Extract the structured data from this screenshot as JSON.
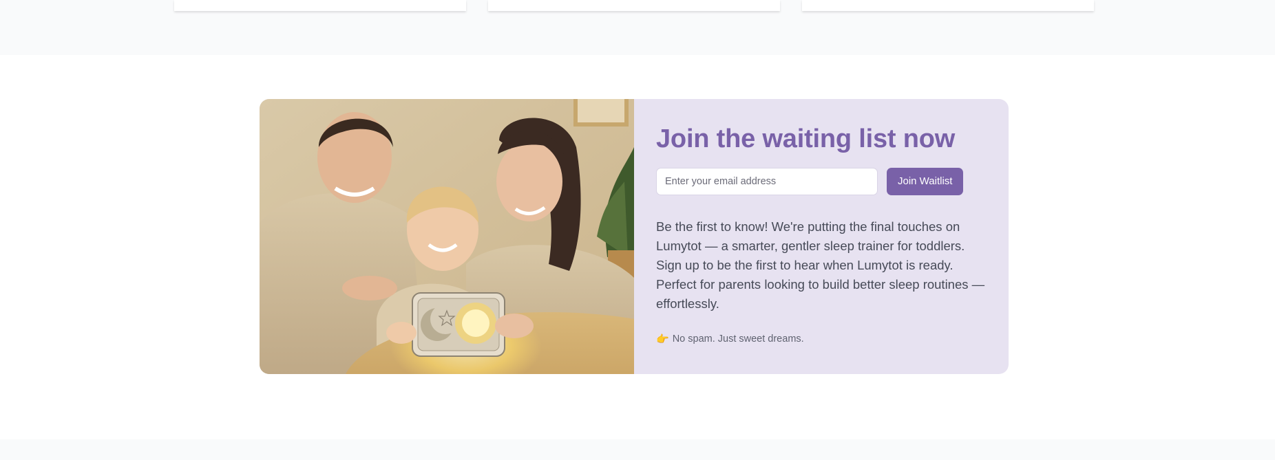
{
  "top_cards": [
    "card-1",
    "card-2",
    "card-3"
  ],
  "waitlist": {
    "headline": "Join the waiting list now",
    "email_placeholder": "Enter your email address",
    "email_value": "",
    "button_label": "Join Waitlist",
    "description": "Be the first to know! We're putting the final touches on Lumytot — a smarter, gentler sleep trainer for toddlers. Sign up to be the first to hear when Lumytot is ready. Perfect for parents looking to build better sleep routines — effortlessly.",
    "note_emoji": "👉",
    "note_text": "No spam. Just sweet dreams."
  },
  "colors": {
    "accent": "#7961a8",
    "panel_bg": "#e7e2f1",
    "band_bg": "#f9fafb",
    "text": "#464a57"
  },
  "photo": {
    "icon_name": "family-with-sleep-trainer-photo"
  }
}
